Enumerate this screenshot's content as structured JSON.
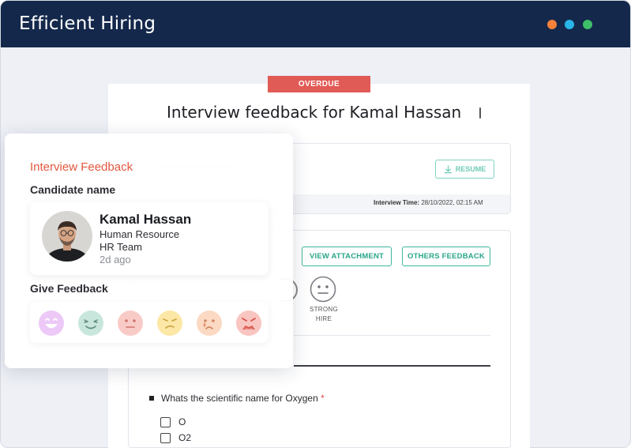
{
  "window": {
    "title": "Efficient Hiring",
    "dots": [
      "#f6813a",
      "#29b5e8",
      "#3fbf6a"
    ]
  },
  "feedback_card": {
    "status_badge": "OVERDUE",
    "title": "Interview feedback for Kamal Hassan",
    "resume_button": "RESUME",
    "interview_time_label": "Interview Time:",
    "interview_time_value": "28/10/2022, 02:15 AM",
    "view_attachment_button": "VIEW ATTACHMENT",
    "others_feedback_button": "OTHERS FEEDBACK",
    "rating_option": {
      "line1": "STRONG",
      "line2": "HIRE",
      "icon": "neutral-face-icon"
    },
    "question": {
      "text": "Whats the scientific name for Oxygen",
      "required_mark": "*",
      "options": [
        "O",
        "O2"
      ]
    }
  },
  "overlay": {
    "title": "Interview Feedback",
    "candidate_label": "Candidate name",
    "candidate": {
      "name": "Kamal Hassan",
      "department": "Human Resource",
      "team": "HR Team",
      "time_ago": "2d ago"
    },
    "give_feedback_label": "Give Feedback",
    "emojis": [
      {
        "icon": "grinning-face-icon",
        "color": "#e6c4f5"
      },
      {
        "icon": "smiling-face-icon",
        "color": "#c4e3da"
      },
      {
        "icon": "neutral-face-icon",
        "color": "#f8c7c4"
      },
      {
        "icon": "confused-face-icon",
        "color": "#fbe6a3"
      },
      {
        "icon": "crying-face-icon",
        "color": "#fbd8c2"
      },
      {
        "icon": "angry-face-icon",
        "color": "#f8c3c0"
      }
    ]
  },
  "colors": {
    "titlebar": "#14284b",
    "accent_teal": "#2aa68a",
    "overdue_red": "#e15b56",
    "overlay_title": "#e2583e"
  }
}
